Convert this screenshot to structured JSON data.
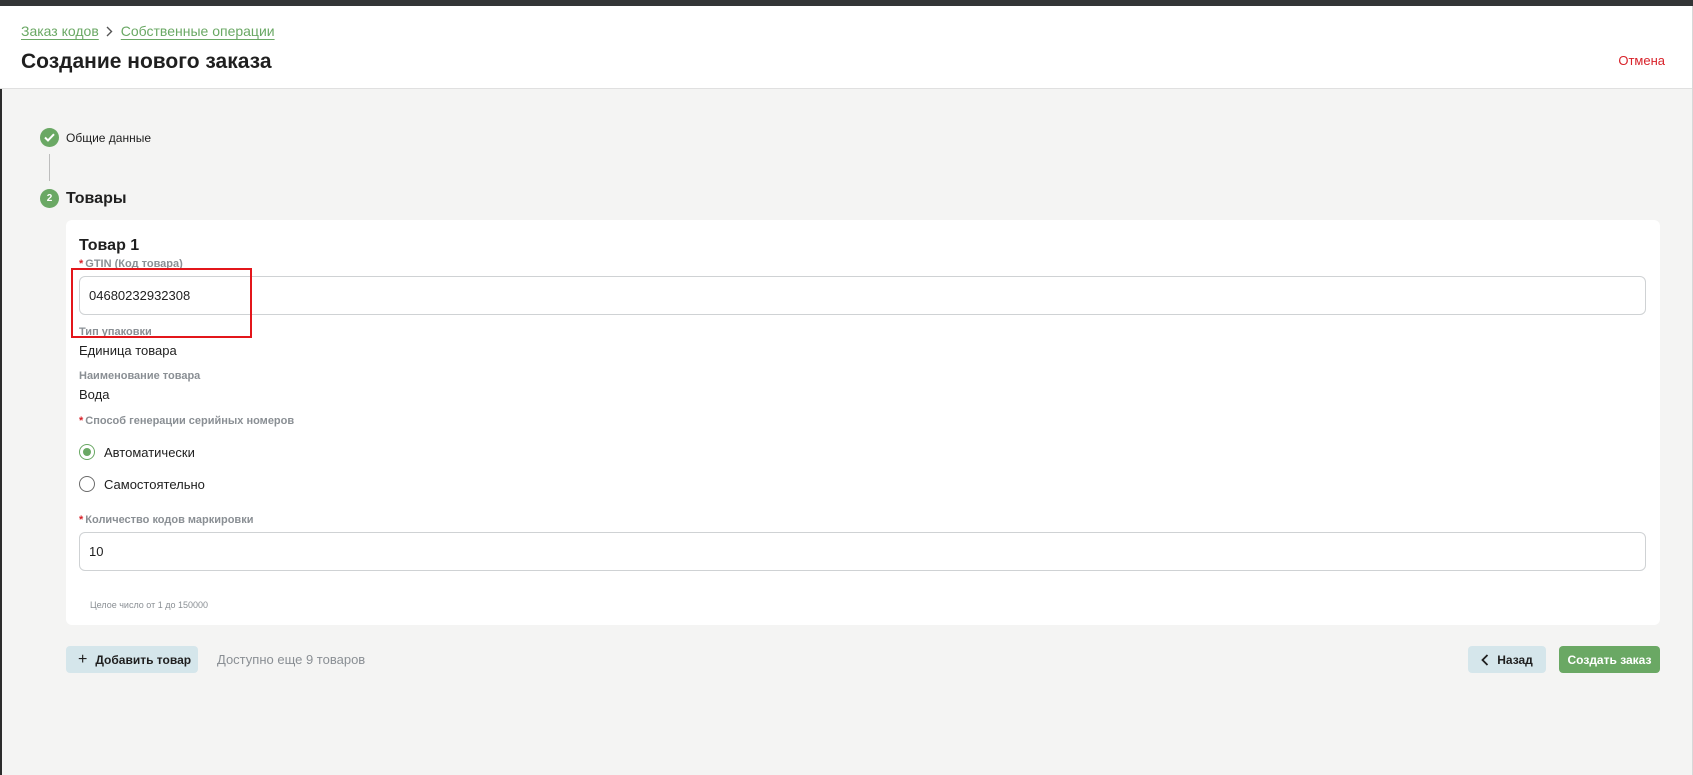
{
  "breadcrumb": {
    "items": [
      "Заказ кодов",
      "Собственные операции"
    ]
  },
  "page": {
    "title": "Создание нового заказа",
    "cancel_label": "Отмена"
  },
  "steps": [
    {
      "label": "Общие данные",
      "status": "done",
      "icon": "check-icon"
    },
    {
      "number": "2",
      "label": "Товары",
      "status": "active"
    }
  ],
  "item": {
    "title": "Товар 1",
    "gtin": {
      "label": "GTIN (Код товара)",
      "value": "04680232932308",
      "required": true
    },
    "package_type": {
      "label": "Тип упаковки",
      "value": "Единица товара"
    },
    "product_name": {
      "label": "Наименование товара",
      "value": "Вода"
    },
    "serial_generation": {
      "label": "Способ генерации серийных номеров",
      "required": true,
      "options": [
        {
          "label": "Автоматически",
          "selected": true
        },
        {
          "label": "Самостоятельно",
          "selected": false
        }
      ]
    },
    "codes_count": {
      "label": "Количество кодов маркировки",
      "value": "10",
      "hint": "Целое число от 1 до 150000",
      "required": true
    }
  },
  "footer": {
    "add_label": "Добавить товар",
    "available_text": "Доступно еще 9 товаров",
    "back_label": "Назад",
    "create_label": "Создать заказ"
  },
  "colors": {
    "accent": "#6aa864",
    "danger": "#d8222a",
    "secondary_button": "#d5e6eb",
    "highlight": "#e3161b"
  }
}
